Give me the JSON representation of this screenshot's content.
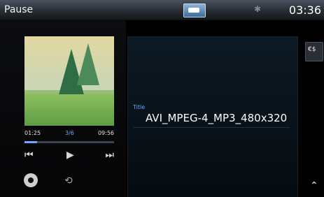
{
  "status_bar": {
    "state": "Pause",
    "clock": "03:36",
    "source_icon": "media-source-icon",
    "bluetooth_icon": "bluetooth-icon"
  },
  "player": {
    "time_elapsed": "01:25",
    "track_position": "3/6",
    "time_total": "09:56",
    "progress_fraction": 0.143,
    "controls": {
      "prev_icon": "skip-previous-icon",
      "play_icon": "play-icon",
      "next_icon": "skip-next-icon"
    },
    "settings_icon": "gear-icon",
    "repeat_icon": "repeat-icon",
    "title_label": "Title",
    "title": "AVI_MPEG-4_MP3_480x320"
  },
  "right_panel": {
    "currency_icon": "€$",
    "scroll_up_icon": "double-chevron-up-icon"
  },
  "colors": {
    "accent": "#6aa9ff",
    "background": "#000000"
  }
}
